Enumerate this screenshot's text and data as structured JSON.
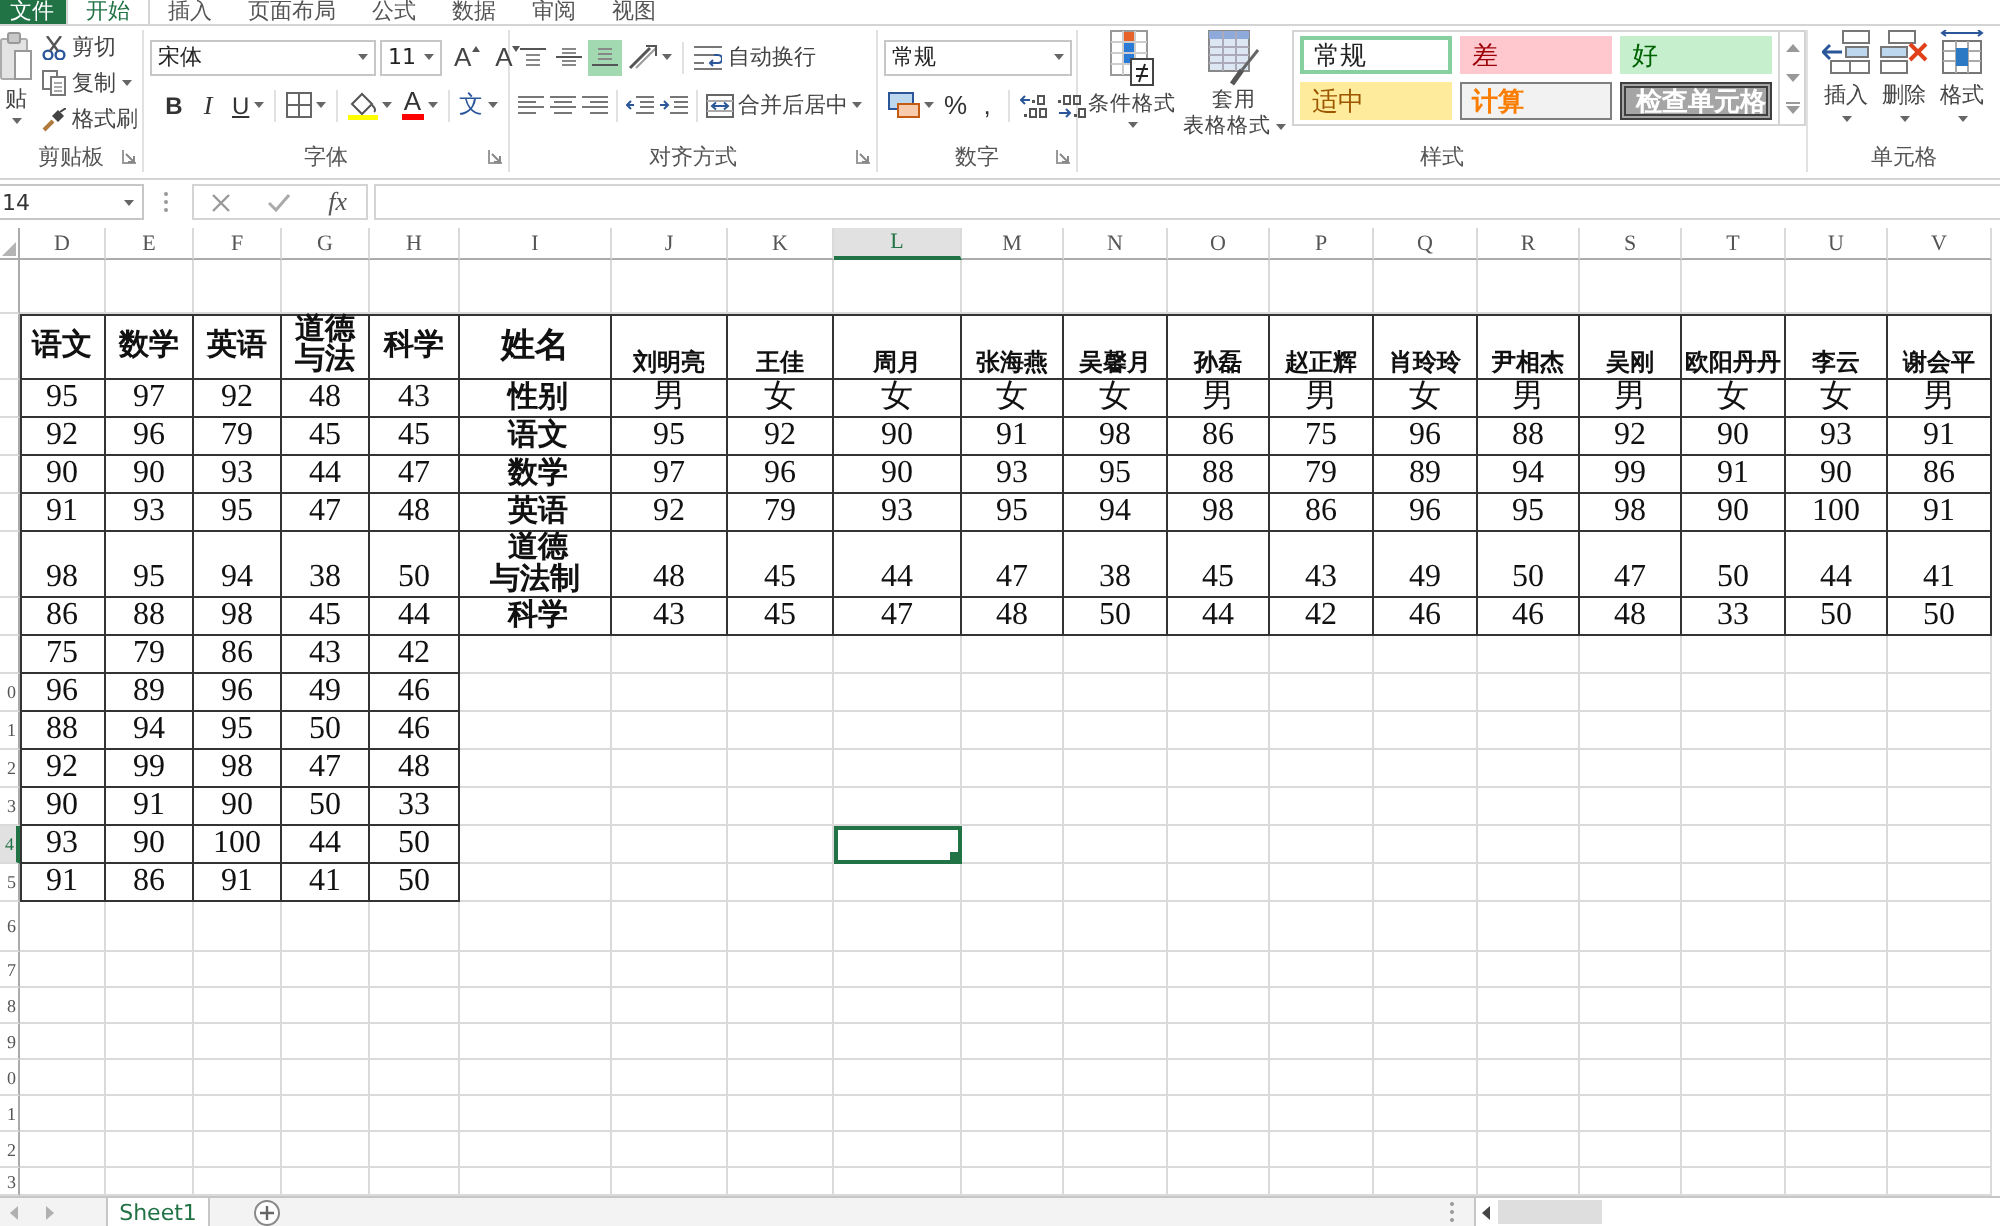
{
  "tabs": [
    {
      "label": "文件",
      "kind": "file",
      "selected": false
    },
    {
      "label": "开始",
      "kind": "tab",
      "selected": true
    },
    {
      "label": "插入",
      "kind": "tab",
      "selected": false
    },
    {
      "label": "页面布局",
      "kind": "tab",
      "selected": false
    },
    {
      "label": "公式",
      "kind": "tab",
      "selected": false
    },
    {
      "label": "数据",
      "kind": "tab",
      "selected": false
    },
    {
      "label": "审阅",
      "kind": "tab",
      "selected": false
    },
    {
      "label": "视图",
      "kind": "tab",
      "selected": false
    }
  ],
  "ribbon": {
    "clipboard": {
      "paste": "贴",
      "cut": "剪切",
      "copy": "复制",
      "format_painter": "格式刷",
      "label": "剪贴板"
    },
    "font": {
      "font_name": "宋体",
      "font_size": "11",
      "grow_font": "A",
      "shrink_font": "A",
      "bold": "B",
      "italic": "I",
      "underline": "U",
      "font_color": "A",
      "phonetic": "文",
      "label": "字体"
    },
    "alignment": {
      "vertical_align": [
        {
          "kind": "top",
          "selected": false
        },
        {
          "kind": "middle",
          "selected": false
        },
        {
          "kind": "bottom",
          "selected": true
        }
      ],
      "wrap_text": "自动换行",
      "merge_center": "合并后居中",
      "label": "对齐方式"
    },
    "number": {
      "format": "常规",
      "percent": "%",
      "comma": ",",
      "label": "数字"
    },
    "styles": {
      "conditional_format": "条件格式",
      "table_format": [
        "套用",
        "表格格式"
      ],
      "gallery": [
        {
          "label": "常规",
          "kind": "normal",
          "selected": true
        },
        {
          "label": "差",
          "kind": "bad",
          "selected": false
        },
        {
          "label": "好",
          "kind": "good",
          "selected": false
        },
        {
          "label": "适中",
          "kind": "neutral",
          "selected": false
        },
        {
          "label": "计算",
          "kind": "calculation",
          "selected": false
        },
        {
          "label": "检查单元格",
          "kind": "check_cell",
          "selected": false
        }
      ],
      "label": "样式"
    },
    "cells": {
      "insert": "插入",
      "delete": "删除",
      "format": "格式",
      "label": "单元格"
    }
  },
  "formula_bar": {
    "name_box": "14",
    "function_label": "fx"
  },
  "sheet": {
    "columns": [
      {
        "label": "D",
        "selected": false
      },
      {
        "label": "E",
        "selected": false
      },
      {
        "label": "F",
        "selected": false
      },
      {
        "label": "G",
        "selected": false
      },
      {
        "label": "H",
        "selected": false
      },
      {
        "label": "I",
        "selected": false
      },
      {
        "label": "J",
        "selected": false
      },
      {
        "label": "K",
        "selected": false
      },
      {
        "label": "L",
        "selected": true
      },
      {
        "label": "M",
        "selected": false
      },
      {
        "label": "N",
        "selected": false
      },
      {
        "label": "O",
        "selected": false
      },
      {
        "label": "P",
        "selected": false
      },
      {
        "label": "Q",
        "selected": false
      },
      {
        "label": "R",
        "selected": false
      },
      {
        "label": "S",
        "selected": false
      },
      {
        "label": "T",
        "selected": false
      },
      {
        "label": "U",
        "selected": false
      },
      {
        "label": "V",
        "selected": false
      }
    ],
    "row_headers": [
      {
        "selected": false
      },
      {
        "selected": false
      },
      {
        "selected": false
      },
      {
        "selected": false
      },
      {
        "selected": false
      },
      {
        "selected": false
      },
      {
        "selected": false
      },
      {
        "selected": false
      },
      {
        "selected": false
      },
      {
        "label": "0",
        "selected": false
      },
      {
        "label": "1",
        "selected": false
      },
      {
        "label": "2",
        "selected": false
      },
      {
        "label": "3",
        "selected": false
      },
      {
        "label": "4",
        "selected": true
      },
      {
        "label": "5",
        "selected": false
      },
      {
        "label": "6",
        "selected": false
      },
      {
        "label": "7",
        "selected": false
      },
      {
        "label": "8",
        "selected": false
      },
      {
        "label": "9",
        "selected": false
      },
      {
        "label": "0",
        "selected": false
      },
      {
        "label": "1",
        "selected": false
      },
      {
        "label": "2",
        "selected": false
      },
      {
        "label": "3",
        "selected": false
      }
    ],
    "score_table": {
      "header": [
        "语文",
        "数学",
        "英语",
        "道德与法",
        "科学"
      ],
      "rows": [
        [
          "95",
          "97",
          "92",
          "48",
          "43"
        ],
        [
          "92",
          "96",
          "79",
          "45",
          "45"
        ],
        [
          "90",
          "90",
          "93",
          "44",
          "47"
        ],
        [
          "91",
          "93",
          "95",
          "47",
          "48"
        ],
        [
          "98",
          "95",
          "94",
          "38",
          "50"
        ],
        [
          "86",
          "88",
          "98",
          "45",
          "44"
        ],
        [
          "75",
          "79",
          "86",
          "43",
          "42"
        ],
        [
          "96",
          "89",
          "96",
          "49",
          "46"
        ],
        [
          "88",
          "94",
          "95",
          "50",
          "46"
        ],
        [
          "92",
          "99",
          "98",
          "47",
          "48"
        ],
        [
          "90",
          "91",
          "90",
          "50",
          "33"
        ],
        [
          "93",
          "90",
          "100",
          "44",
          "50"
        ],
        [
          "91",
          "86",
          "91",
          "41",
          "50"
        ]
      ]
    },
    "student_table": {
      "header": {
        "label": "姓名",
        "names": [
          "刘明亮",
          "王佳",
          "周月",
          "张海燕",
          "吴馨月",
          "孙磊",
          "赵正辉",
          "肖玲玲",
          "尹相杰",
          "吴刚",
          "欧阳丹丹",
          "李云",
          "谢会平"
        ]
      },
      "rows": [
        {
          "label": "性别",
          "values": [
            "男",
            "女",
            "女",
            "女",
            "女",
            "男",
            "男",
            "女",
            "男",
            "男",
            "女",
            "女",
            "男"
          ]
        },
        {
          "label": "语文",
          "values": [
            "95",
            "92",
            "90",
            "91",
            "98",
            "86",
            "75",
            "96",
            "88",
            "92",
            "90",
            "93",
            "91"
          ]
        },
        {
          "label": "数学",
          "values": [
            "97",
            "96",
            "90",
            "93",
            "95",
            "88",
            "79",
            "89",
            "94",
            "99",
            "91",
            "90",
            "86"
          ]
        },
        {
          "label": "英语",
          "values": [
            "92",
            "79",
            "93",
            "95",
            "94",
            "98",
            "86",
            "96",
            "95",
            "98",
            "90",
            "100",
            "91"
          ]
        },
        {
          "label": "道德与法制",
          "values": [
            "48",
            "45",
            "44",
            "47",
            "38",
            "45",
            "43",
            "49",
            "50",
            "47",
            "50",
            "44",
            "41"
          ]
        },
        {
          "label": "科学",
          "values": [
            "43",
            "45",
            "47",
            "48",
            "50",
            "44",
            "42",
            "46",
            "46",
            "48",
            "33",
            "50",
            "50"
          ]
        }
      ]
    }
  },
  "sheet_tabs": [
    {
      "label": "Sheet1",
      "selected": true
    }
  ]
}
